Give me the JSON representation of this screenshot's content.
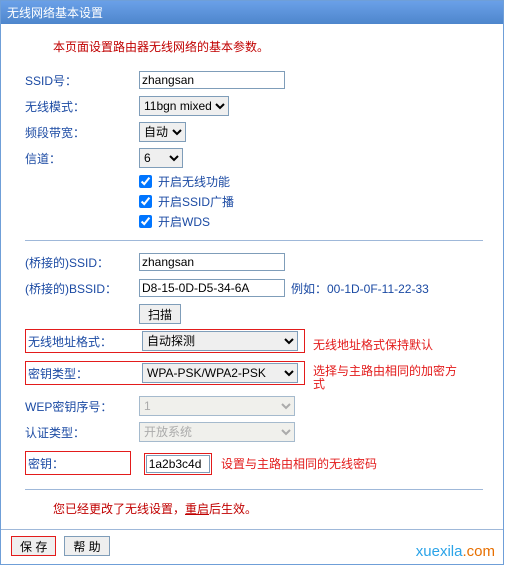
{
  "title": "无线网络基本设置",
  "intro": "本页面设置路由器无线网络的基本参数。",
  "labels": {
    "ssid": "SSID号：",
    "mode": "无线模式：",
    "bandwidth": "频段带宽：",
    "channel": "信道：",
    "wifi_on": "开启无线功能",
    "ssid_bc": "开启SSID广播",
    "wds": "开启WDS",
    "bridge_ssid": "(桥接的)SSID：",
    "bridge_bssid": "(桥接的)BSSID：",
    "scan": "扫描",
    "addr_fmt": "无线地址格式：",
    "key_type": "密钥类型：",
    "wep_idx": "WEP密钥序号：",
    "auth": "认证类型：",
    "key": "密钥："
  },
  "values": {
    "ssid": "zhangsan",
    "mode": "11bgn mixed",
    "bandwidth": "自动",
    "channel": "6",
    "bridge_ssid": "zhangsan",
    "bridge_bssid": "D8-15-0D-D5-34-6A",
    "addr_fmt": "自动探测",
    "key_type": "WPA-PSK/WPA2-PSK",
    "wep_idx": "1",
    "auth": "开放系统",
    "key": "1a2b3c4d"
  },
  "notes": {
    "bssid_example": "例如：00-1D-0F-11-22-33",
    "addr_fmt": "无线地址格式保持默认",
    "key_type": "选择与主路由相同的加密方式",
    "key": "设置与主路由相同的无线密码"
  },
  "changed_msg": {
    "pre": "您已经更改了无线设置，",
    "u": "重启",
    "post": "后生效。"
  },
  "buttons": {
    "save": "保 存",
    "help": "帮 助"
  },
  "watermark": {
    "a": "xuexila",
    "b": ".com"
  }
}
